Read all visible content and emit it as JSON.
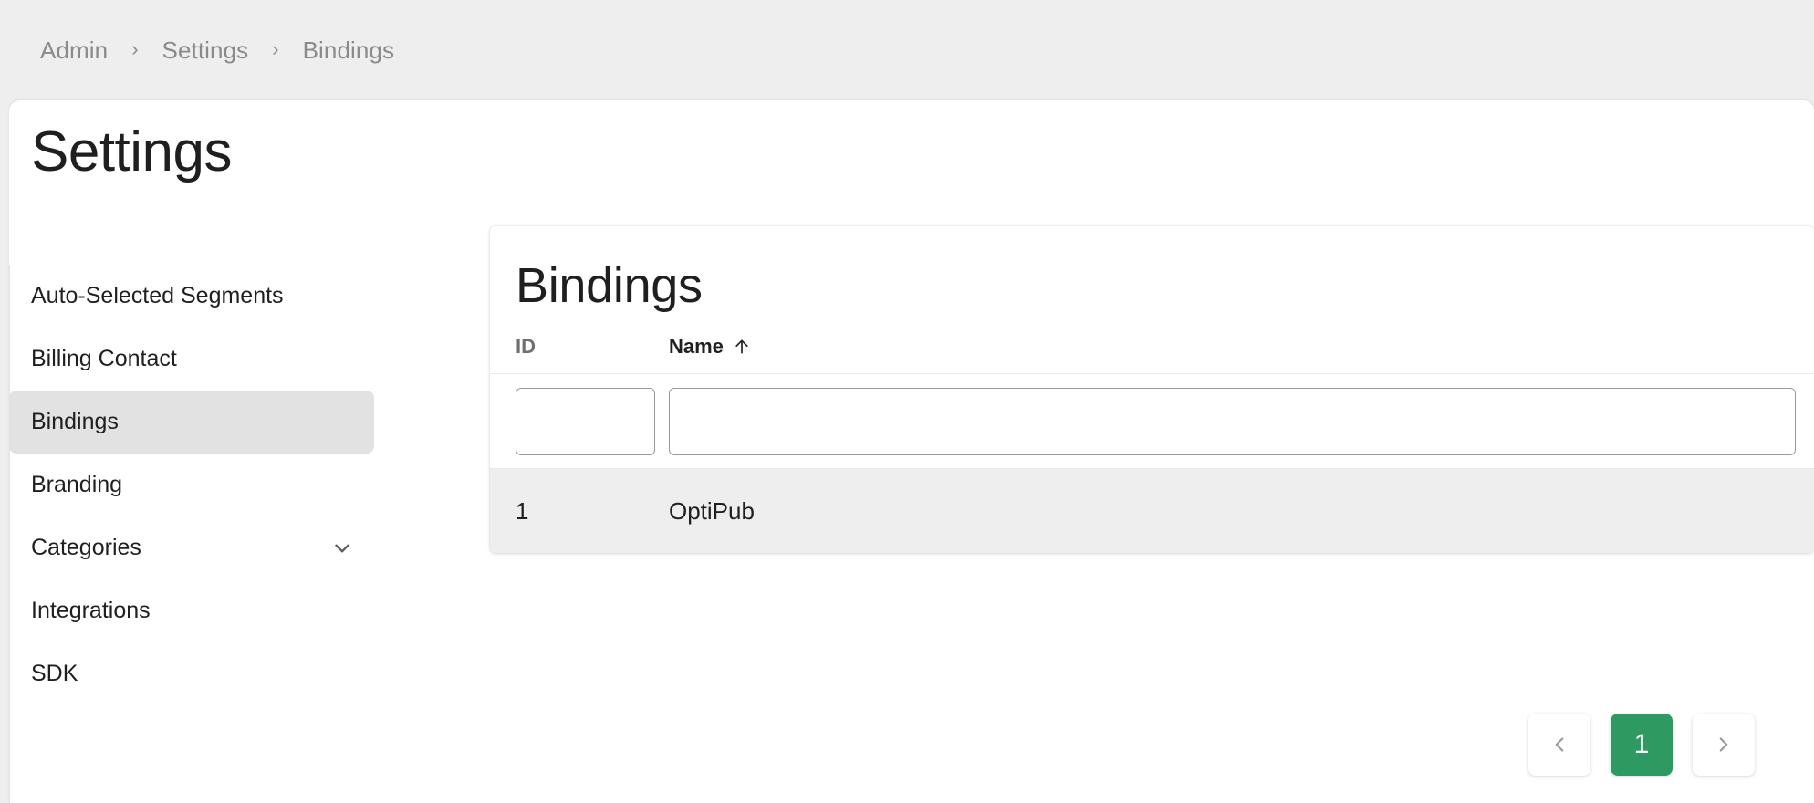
{
  "breadcrumb": {
    "items": [
      {
        "label": "Admin"
      },
      {
        "label": "Settings"
      },
      {
        "label": "Bindings"
      }
    ],
    "separator": "›"
  },
  "page": {
    "title": "Settings"
  },
  "settings_nav": {
    "items": [
      {
        "label": "Auto-Selected Segments",
        "active": false,
        "expandable": false
      },
      {
        "label": "Billing Contact",
        "active": false,
        "expandable": false
      },
      {
        "label": "Bindings",
        "active": true,
        "expandable": false
      },
      {
        "label": "Branding",
        "active": false,
        "expandable": false
      },
      {
        "label": "Categories",
        "active": false,
        "expandable": true
      },
      {
        "label": "Integrations",
        "active": false,
        "expandable": false
      },
      {
        "label": "SDK",
        "active": false,
        "expandable": false
      }
    ]
  },
  "table": {
    "title": "Bindings",
    "columns": [
      {
        "key": "id",
        "label": "ID",
        "sorted": false,
        "sort_direction": ""
      },
      {
        "key": "name",
        "label": "Name",
        "sorted": true,
        "sort_direction": "asc"
      }
    ],
    "filters": {
      "id": {
        "value": "",
        "placeholder": ""
      },
      "name": {
        "value": "",
        "placeholder": ""
      }
    },
    "rows": [
      {
        "id": "1",
        "name": "OptiPub"
      }
    ]
  },
  "pagination": {
    "prev_label": "‹",
    "next_label": "›",
    "current_page": "1",
    "pages": [
      "1"
    ]
  },
  "colors": {
    "accent_green": "#2e9a62",
    "page_background": "#eeeeee",
    "card_background": "#ffffff",
    "nav_active_background": "#e2e2e2",
    "row_background": "#eeeeee",
    "muted_text": "#8a8a8a"
  },
  "icons": {
    "chevron_right": "chevron-right-icon",
    "chevron_down": "chevron-down-icon",
    "chevron_left": "chevron-left-icon",
    "sort_arrow_up": "arrow-up-icon"
  }
}
